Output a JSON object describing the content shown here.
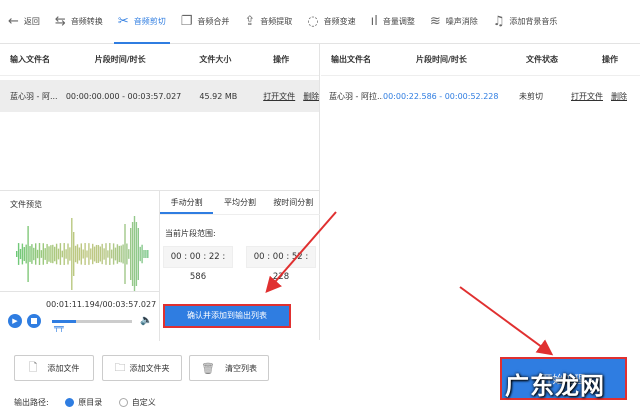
{
  "toolbar": {
    "back": "返回",
    "items": [
      "音频转换",
      "音频剪切",
      "音频合并",
      "音频提取",
      "音频变速",
      "音量调整",
      "噪声消除",
      "添加背景音乐"
    ],
    "active": 1
  },
  "input_table": {
    "headers": [
      "输入文件名",
      "片段时间/时长",
      "文件大小",
      "操作"
    ],
    "rows": [
      {
        "name": "蓝心羽 - 阿...",
        "time": "00:00:00.000 - 00:03:57.027",
        "size": "45.92 MB",
        "open": "打开文件",
        "delete": "删除"
      }
    ]
  },
  "output_table": {
    "headers": [
      "输出文件名",
      "片段时间/时长",
      "文件状态",
      "操作"
    ],
    "rows": [
      {
        "name": "蓝心羽 - 阿拉...",
        "time": "00:00:22.586 - 00:00:52.228",
        "status": "未剪切",
        "open": "打开文件",
        "delete": "删除"
      }
    ]
  },
  "preview": {
    "title": "文件预览",
    "time": "00:01:11.194/00:03:57.027",
    "progress": 0.3
  },
  "split": {
    "tabs": [
      "手动分割",
      "平均分割",
      "按时间分割"
    ],
    "range_label": "当前片段范围:",
    "start": "00 : 00 : 22 : 586",
    "end": "00 : 00 : 52 : 228",
    "confirm": "确认并添加到输出列表"
  },
  "buttons": {
    "add_file": "添加文件",
    "add_folder": "添加文件夹",
    "clear": "清空列表",
    "start": "开始处理"
  },
  "output_path": {
    "label": "输出路径:",
    "options": [
      "原目录",
      "自定义"
    ],
    "selected": 0
  },
  "watermark": "广东龙网",
  "colors": {
    "accent": "#2f7de1",
    "highlight": "#e03030"
  }
}
